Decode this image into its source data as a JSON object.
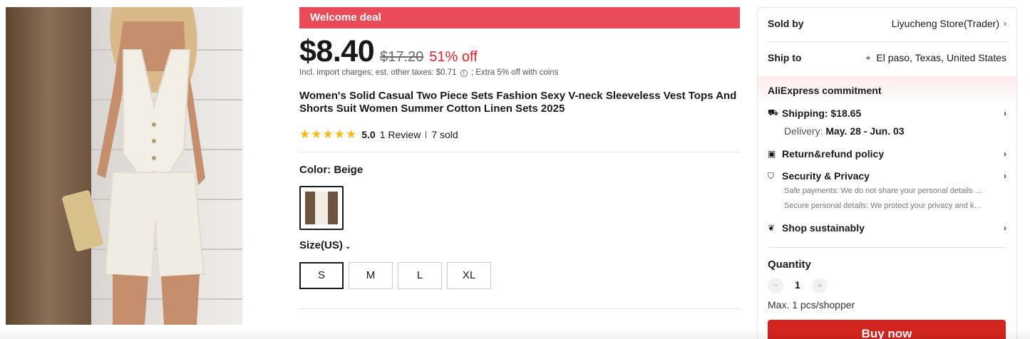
{
  "product": {
    "image_alt": "product-photo",
    "deal_banner": "Welcome deal",
    "price": "$8.40",
    "original_price": "$17.20",
    "discount": "51% off",
    "tax_line_prefix": "Incl. import charges; est. other taxes: $0.71",
    "tax_line_suffix": "; Extra 5% off with coins",
    "title": "Women's Solid Casual Two Piece Sets Fashion Sexy V-neck Sleeveless Vest Tops And Shorts Suit Women Summer Cotton Linen Sets 2025",
    "rating": {
      "stars": 5,
      "score": "5.0",
      "reviews": "1 Review",
      "sold": "7 sold"
    },
    "color_label": "Color: Beige",
    "size_label": "Size(US)",
    "sizes": [
      "S",
      "M",
      "L",
      "XL"
    ],
    "selected_size": "S"
  },
  "panel": {
    "sold_by_label": "Sold by",
    "sold_by_value": "Liyucheng Store(Trader)",
    "ship_to_label": "Ship to",
    "ship_to_value": "El paso, Texas, United States",
    "commitment_title": "AliExpress commitment",
    "shipping": "Shipping: $18.65",
    "delivery_label": "Delivery:",
    "delivery_value": "May. 28 - Jun. 03",
    "return_policy": "Return&refund policy",
    "security": "Security & Privacy",
    "security_note_1": "Safe payments: We do not share your personal details with any third parties without your consent.",
    "security_note_2": "Secure personal details: We protect your privacy and keep your personal details safe and secure.",
    "sustainable": "Shop sustainably",
    "quantity_label": "Quantity",
    "quantity_value": "1",
    "max_line": "Max. 1 pcs/shopper",
    "buy_now": "Buy now"
  },
  "colors": {
    "deal_banner": "#ea4b5a",
    "discount": "#e0212f",
    "star": "#fdb913",
    "buy_button": "#d3251f"
  },
  "icons": [
    "info-icon",
    "star-icon",
    "chevron-down-icon",
    "chevron-right-icon",
    "location-pin-icon",
    "truck-icon",
    "return-box-icon",
    "shield-icon",
    "leaf-icon",
    "minus-icon",
    "plus-icon"
  ]
}
